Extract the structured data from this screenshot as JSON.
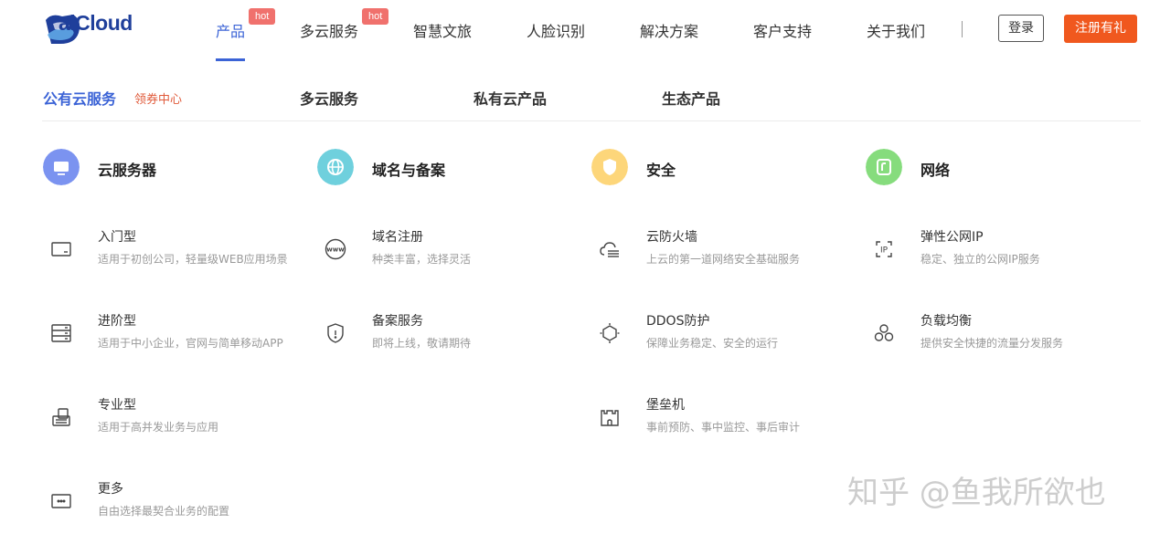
{
  "brand": {
    "name": "aiCloud"
  },
  "nav": {
    "items": [
      "产品",
      "多云服务",
      "智慧文旅",
      "人脸识别",
      "解决方案",
      "客户支持",
      "关于我们"
    ],
    "hot": "hot",
    "login": "登录",
    "register": "注册有礼"
  },
  "subnav": {
    "items": [
      "公有云服务",
      "多云服务",
      "私有云产品",
      "生态产品"
    ],
    "coupon": "领券中心"
  },
  "categories": [
    {
      "title": "云服务器",
      "color": "#7b93f0",
      "items": [
        {
          "title": "入门型",
          "desc": "适用于初创公司，轻量级WEB应用场景"
        },
        {
          "title": "进阶型",
          "desc": "适用于中小企业，官网与简单移动APP"
        },
        {
          "title": "专业型",
          "desc": "适用于高并发业务与应用"
        },
        {
          "title": "更多",
          "desc": "自由选择最契合业务的配置"
        }
      ]
    },
    {
      "title": "域名与备案",
      "color": "#6fd0dd",
      "items": [
        {
          "title": "域名注册",
          "desc": "种类丰富，选择灵活"
        },
        {
          "title": "备案服务",
          "desc": "即将上线，敬请期待"
        }
      ]
    },
    {
      "title": "安全",
      "color": "#fdd67a",
      "items": [
        {
          "title": "云防火墙",
          "desc": "上云的第一道网络安全基础服务"
        },
        {
          "title": "DDOS防护",
          "desc": "保障业务稳定、安全的运行"
        },
        {
          "title": "堡垒机",
          "desc": "事前预防、事中监控、事后审计"
        }
      ]
    },
    {
      "title": "网络",
      "color": "#86dc7d",
      "items": [
        {
          "title": "弹性公网IP",
          "desc": "稳定、独立的公网IP服务"
        },
        {
          "title": "负载均衡",
          "desc": "提供安全快捷的流量分发服务"
        }
      ]
    }
  ],
  "colors": {
    "accent": "#3b63d6",
    "register": "#f0581e",
    "hot_badge": "#f0716d"
  },
  "watermark": "知乎 @鱼我所欲也"
}
